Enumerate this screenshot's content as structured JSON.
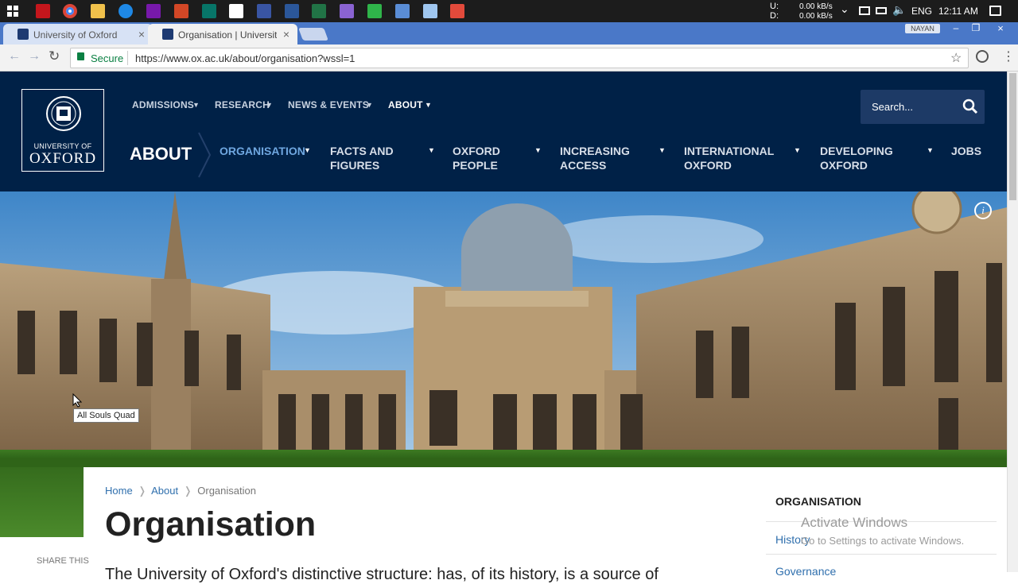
{
  "taskbar": {
    "network_up": "U:",
    "network_down": "D:",
    "up_rate": "0.00 kB/s",
    "down_rate": "0.00 kB/s",
    "language": "ENG",
    "time": "12:11 AM"
  },
  "browser": {
    "tabs": [
      {
        "title": "University of Oxford"
      },
      {
        "title": "Organisation | University"
      }
    ],
    "profile_badge": "NAYAN",
    "secure_label": "Secure",
    "url": "https://www.ox.ac.uk/about/organisation?wssl=1"
  },
  "site": {
    "logo_line1": "UNIVERSITY OF",
    "logo_line2": "OXFORD",
    "top_nav": [
      {
        "label": "ADMISSIONS"
      },
      {
        "label": "RESEARCH"
      },
      {
        "label": "NEWS & EVENTS"
      },
      {
        "label": "ABOUT"
      }
    ],
    "search_placeholder": "Search...",
    "section_title": "ABOUT",
    "sub_nav": [
      {
        "line1": "ORGANISATION",
        "line2": ""
      },
      {
        "line1": "FACTS AND",
        "line2": "FIGURES"
      },
      {
        "line1": "OXFORD",
        "line2": "PEOPLE"
      },
      {
        "line1": "INCREASING",
        "line2": "ACCESS"
      },
      {
        "line1": "INTERNATIONAL",
        "line2": "OXFORD"
      },
      {
        "line1": "DEVELOPING",
        "line2": "OXFORD"
      },
      {
        "line1": "JOBS",
        "line2": ""
      }
    ],
    "hero_tooltip": "All Souls Quad",
    "breadcrumb": [
      "Home",
      "About",
      "Organisation"
    ],
    "page_title": "Organisation",
    "share_label": "SHARE THIS",
    "intro_text": "The University of Oxford's distinctive structure: has, of its history, is a source of",
    "sidebar_title": "ORGANISATION",
    "sidebar_items": [
      "History",
      "Governance"
    ]
  },
  "watermark": {
    "line1": "Activate Windows",
    "line2": "Go to Settings to activate Windows."
  },
  "colors": {
    "oxford_blue": "#002147",
    "link_blue": "#2f6fad",
    "taskbar": "#1c1c1c",
    "tab_strip": "#4a78c8"
  }
}
